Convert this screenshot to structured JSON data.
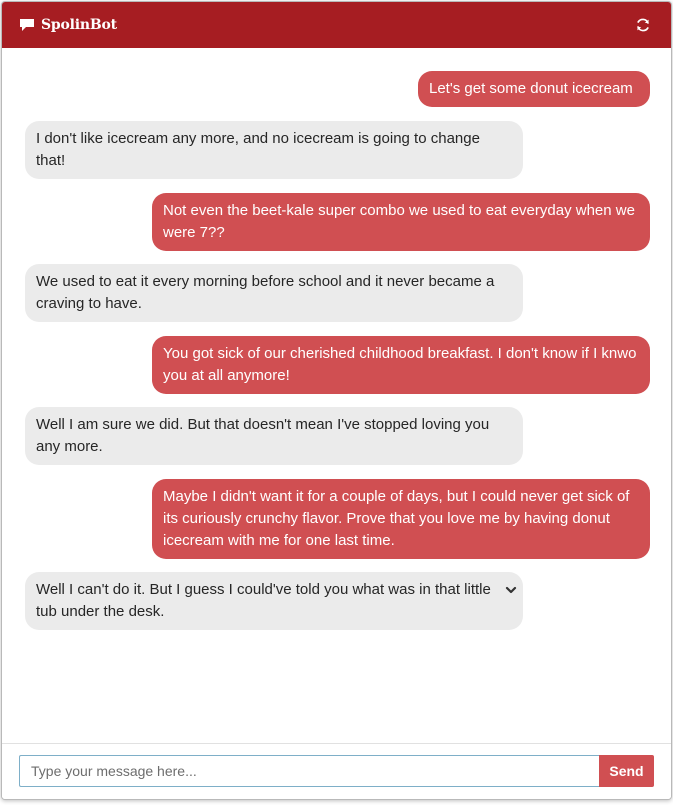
{
  "header": {
    "title": "SpolinBot",
    "chat_icon": "comment-icon",
    "refresh_icon": "refresh-icon"
  },
  "messages": [
    {
      "sender": "user",
      "text": "Let's get some donut icecream"
    },
    {
      "sender": "bot",
      "text": "I don't like icecream any more, and no icecream is going to change that!"
    },
    {
      "sender": "user",
      "text": "Not even the beet-kale super combo we used to eat everyday when we were 7??"
    },
    {
      "sender": "bot",
      "text": "We used to eat it every morning before school and it never became a craving to have."
    },
    {
      "sender": "user",
      "text": "You got sick of our cherished childhood breakfast. I don't know if I knwo you at all anymore!"
    },
    {
      "sender": "bot",
      "text": "Well I am sure we did. But that doesn't mean I've stopped loving you any more."
    },
    {
      "sender": "user",
      "text": "Maybe I didn't want it for a couple of days, but I could never get sick of its curiously crunchy flavor. Prove that you love me by having donut icecream with me for one last time."
    },
    {
      "sender": "bot",
      "text": "Well I can't do it. But I guess I could've told you what was in that little tub under the desk.",
      "icon": "chevron-down-icon"
    }
  ],
  "composer": {
    "placeholder": "Type your message here...",
    "value": "",
    "send_label": "Send"
  },
  "colors": {
    "header": "#a61d22",
    "user_bubble": "#d04f52",
    "bot_bubble": "#ebebeb",
    "send_button": "#d04f52"
  }
}
